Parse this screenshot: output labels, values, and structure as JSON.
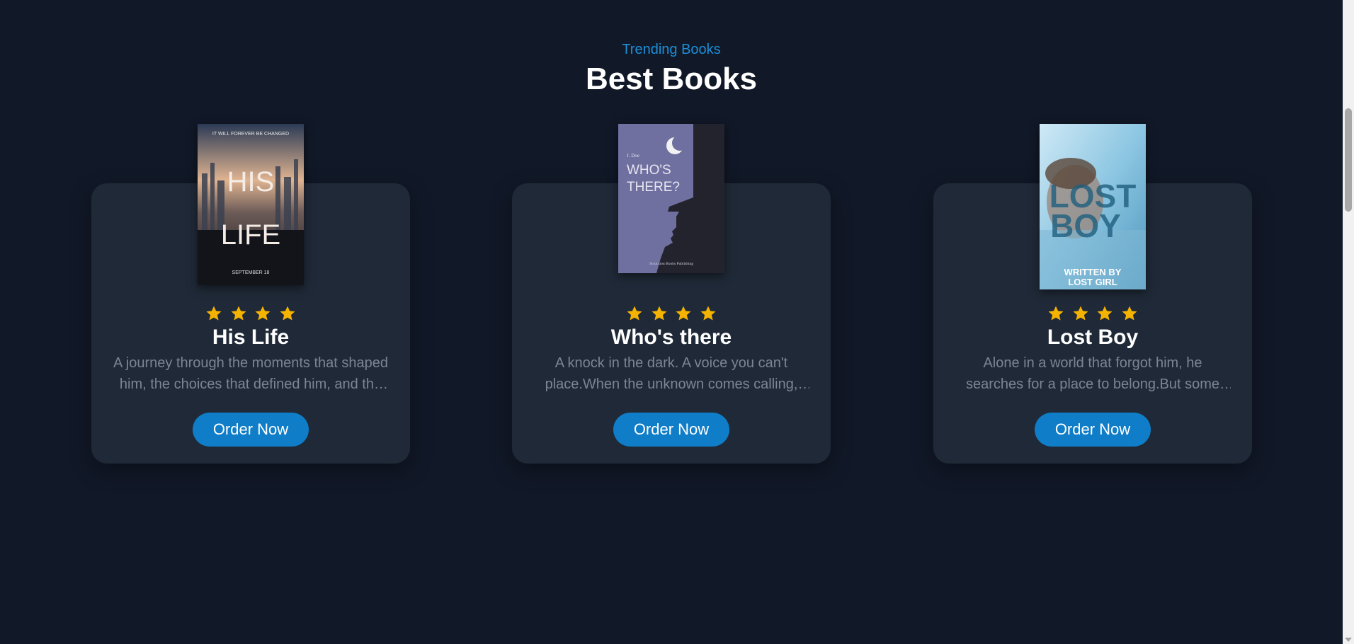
{
  "header": {
    "subtitle": "Trending Books",
    "title": "Best Books"
  },
  "colors": {
    "background": "#111827",
    "card": "#1f2937",
    "accent": "#0f7dc7",
    "star": "#f5b301",
    "subtitle": "#1c8fd9"
  },
  "books": [
    {
      "title": "His Life",
      "description": "A journey through the moments that shaped him, the choices that defined him, and the legacy he left behind.",
      "rating": 4,
      "button": "Order Now",
      "cover": {
        "top_text": "IT WILL FOREVER BE CHANGED",
        "main_text_1": "HIS",
        "main_text_2": "LIFE",
        "date_text": "SEPTEMBER 18"
      }
    },
    {
      "title": "Who's there",
      "description": "A knock in the dark. A voice you can't place.When the unknown comes calling, will you answer?",
      "rating": 4,
      "button": "Order Now",
      "cover": {
        "author": "J. Doe",
        "main_text_1": "WHO'S",
        "main_text_2": "THERE?",
        "publisher": "Sloucsion Books Publishing"
      }
    },
    {
      "title": "Lost Boy",
      "description": "Alone in a world that forgot him, he searches for a place to belong.But some paths lead only further into the dark.",
      "rating": 4,
      "button": "Order Now",
      "cover": {
        "main_text_1": "LOST",
        "main_text_2": "BOY",
        "byline_1": "WRITTEN BY",
        "byline_2": "LOST GIRL"
      }
    }
  ]
}
